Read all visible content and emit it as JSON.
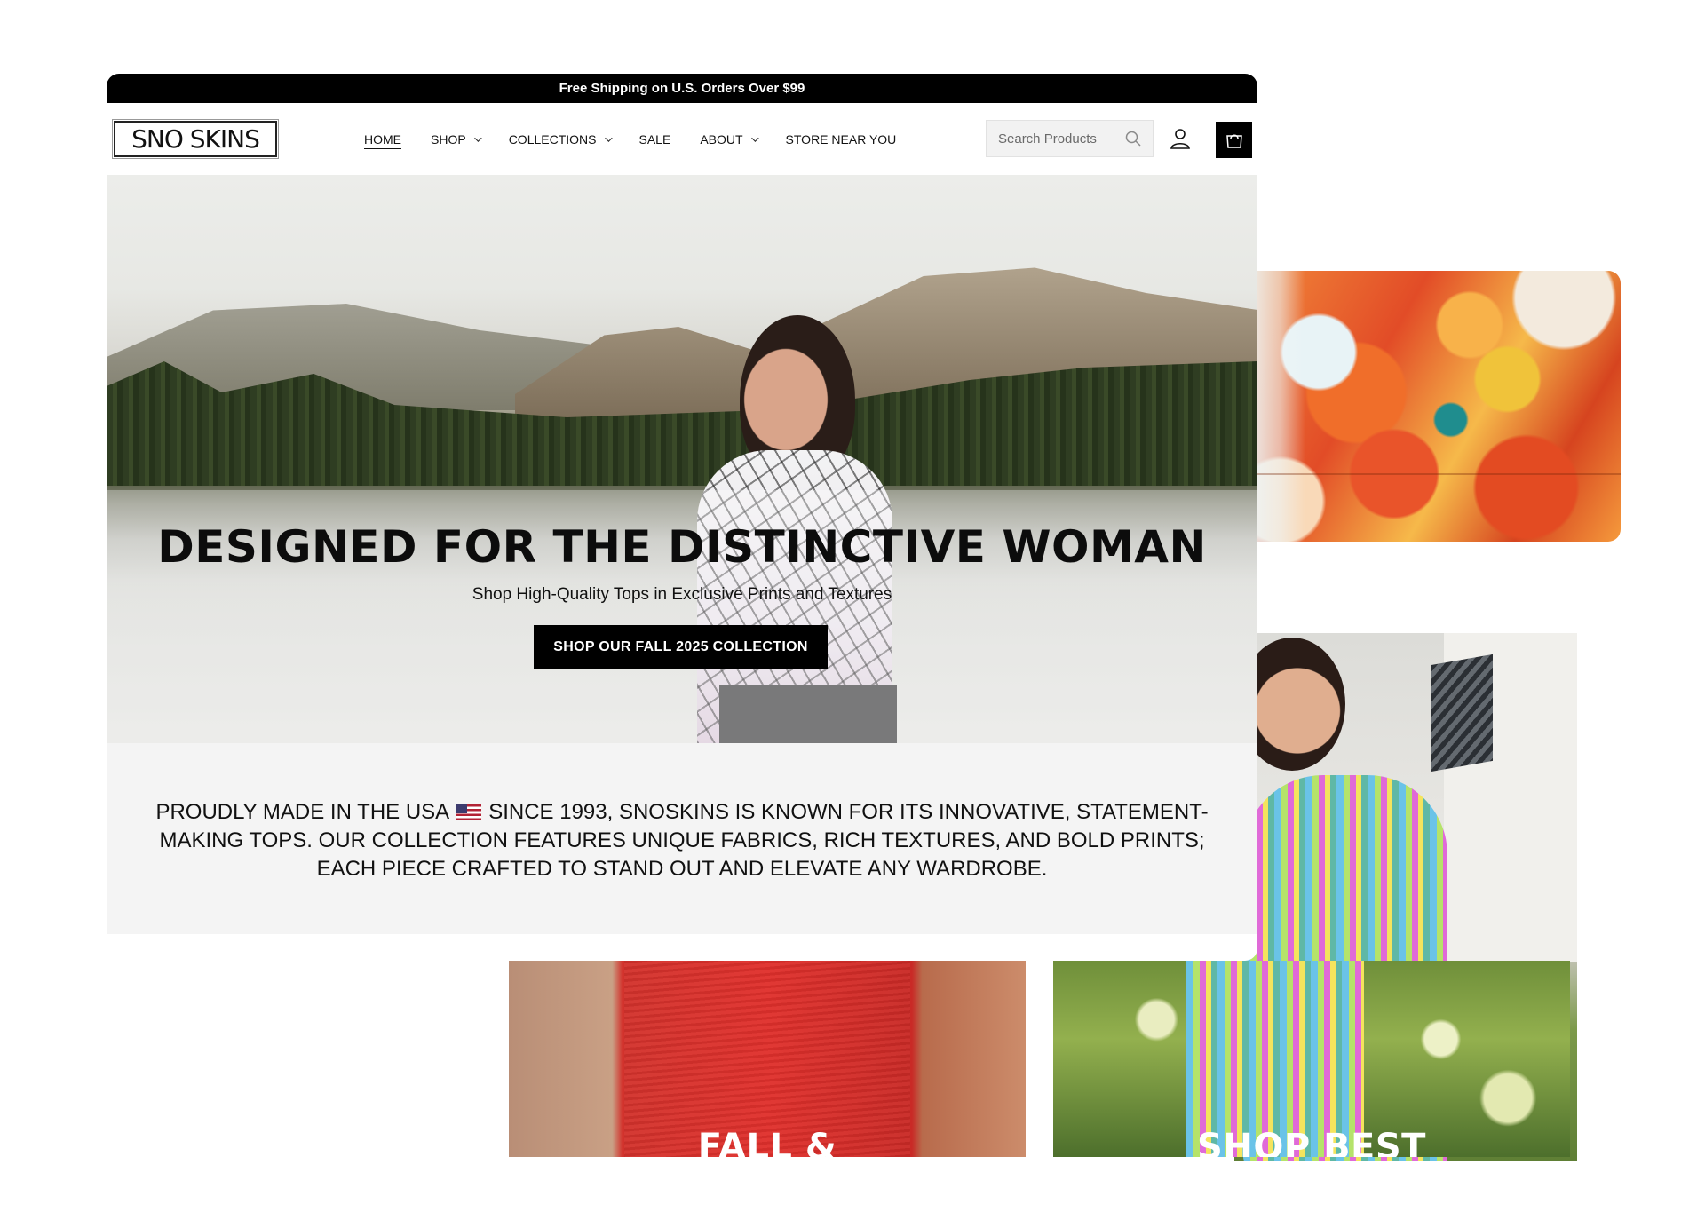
{
  "announcement": {
    "text": "Free Shipping on U.S. Orders Over $99"
  },
  "header": {
    "logo_text": "SNO SKINS",
    "nav": [
      {
        "label": "HOME",
        "active": true,
        "has_dropdown": false
      },
      {
        "label": "SHOP",
        "active": false,
        "has_dropdown": true
      },
      {
        "label": "COLLECTIONS",
        "active": false,
        "has_dropdown": true
      },
      {
        "label": "SALE",
        "active": false,
        "has_dropdown": false
      },
      {
        "label": "ABOUT",
        "active": false,
        "has_dropdown": true
      },
      {
        "label": "STORE NEAR YOU",
        "active": false,
        "has_dropdown": false
      }
    ],
    "search": {
      "placeholder": "Search Products",
      "value": "",
      "icon": "search-icon"
    },
    "account_icon": "user-icon",
    "cart_icon": "cart-icon"
  },
  "hero": {
    "title": "DESIGNED FOR THE DISTINCTIVE WOMAN",
    "subtitle": "Shop High-Quality Tops in Exclusive Prints and Textures",
    "cta_label": "SHOP OUR FALL 2025 COLLECTION"
  },
  "about": {
    "text_before_flag": "PROUDLY MADE IN THE USA",
    "flag_icon": "us-flag-icon",
    "text_after_flag": "SINCE 1993, SNOSKINS IS KNOWN FOR ITS INNOVATIVE, STATEMENT-MAKING TOPS. OUR COLLECTION FEATURES UNIQUE FABRICS, RICH TEXTURES, AND BOLD PRINTS; EACH PIECE CRAFTED TO STAND OUT AND ELEVATE ANY WARDROBE."
  },
  "tiles": [
    {
      "title": "FALL &"
    },
    {
      "title": "SHOP BEST"
    }
  ],
  "colors": {
    "announcement_bg": "#000000",
    "about_bg": "#f4f4f4",
    "cta_bg": "#000000",
    "cta_text": "#ffffff"
  }
}
